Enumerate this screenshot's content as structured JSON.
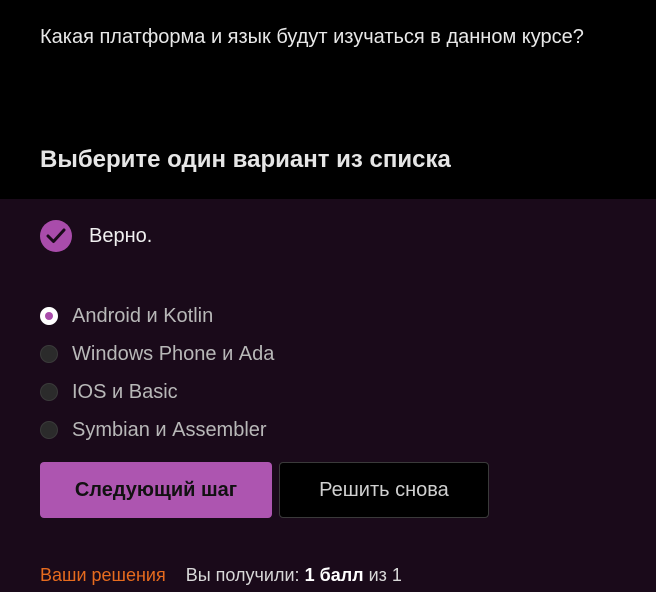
{
  "question": {
    "text": "Какая платформа и язык будут изучаться в данном курсе?",
    "instruction": "Выберите один вариант из списка"
  },
  "feedback": {
    "icon": "checkmark-icon",
    "text": "Верно."
  },
  "options": [
    {
      "label": "Android и Kotlin",
      "selected": true
    },
    {
      "label": "Windows Phone и Ada",
      "selected": false
    },
    {
      "label": "IOS и Basic",
      "selected": false
    },
    {
      "label": "Symbian и Assembler",
      "selected": false
    }
  ],
  "buttons": {
    "next_label": "Следующий шаг",
    "retry_label": "Решить снова"
  },
  "footer": {
    "solutions_link": "Ваши решения",
    "score_prefix": "Вы получили:",
    "score_value": "1 балл",
    "score_suffix": "из 1"
  },
  "colors": {
    "accent": "#ad55b0",
    "link": "#e66b1e",
    "question_bg": "#000000",
    "answer_bg": "#1a0a1a"
  }
}
